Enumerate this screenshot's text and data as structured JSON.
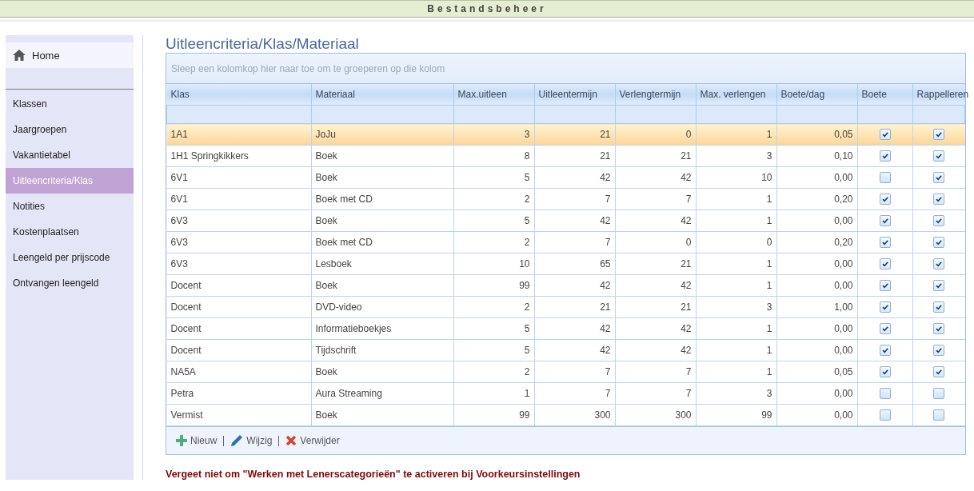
{
  "header": {
    "title": "Bestandsbeheer"
  },
  "sidebar": {
    "home": {
      "label": "Home"
    },
    "items": [
      {
        "label": "Klassen",
        "selected": false
      },
      {
        "label": "Jaargroepen",
        "selected": false
      },
      {
        "label": "Vakantietabel",
        "selected": false
      },
      {
        "label": "Uitleencriteria/Klas",
        "selected": true
      },
      {
        "label": "Notities",
        "selected": false
      },
      {
        "label": "Kostenplaatsen",
        "selected": false
      },
      {
        "label": "Leengeld per prijscode",
        "selected": false
      },
      {
        "label": "Ontvangen leengeld",
        "selected": false
      }
    ]
  },
  "page_title": "Uitleencriteria/Klas/Materiaal",
  "grid": {
    "group_hint": "Sleep een kolomkop hier naar toe om te groeperen op die kolom",
    "columns": [
      {
        "label": "Klas",
        "kind": "text"
      },
      {
        "label": "Materiaal",
        "kind": "text"
      },
      {
        "label": "Max.uitleen",
        "kind": "number"
      },
      {
        "label": "Uitleentermijn",
        "kind": "number"
      },
      {
        "label": "Verlengtermijn",
        "kind": "number"
      },
      {
        "label": "Max. verlengen",
        "kind": "number"
      },
      {
        "label": "Boete/dag",
        "kind": "number"
      },
      {
        "label": "Boete",
        "kind": "check"
      },
      {
        "label": "Rappelleren",
        "kind": "check"
      }
    ],
    "rows": [
      {
        "selected": true,
        "values": [
          "1A1",
          "JoJu",
          "3",
          "21",
          "0",
          "1",
          "0,05"
        ],
        "checks": [
          {
            "checked": true
          },
          {
            "checked": true
          }
        ]
      },
      {
        "selected": false,
        "values": [
          "1H1 Springkikkers",
          "Boek",
          "8",
          "21",
          "21",
          "3",
          "0,10"
        ],
        "checks": [
          {
            "checked": true
          },
          {
            "checked": true
          }
        ]
      },
      {
        "selected": false,
        "values": [
          "6V1",
          "Boek",
          "5",
          "42",
          "42",
          "10",
          "0,00"
        ],
        "checks": [
          {
            "checked": false
          },
          {
            "checked": true
          }
        ]
      },
      {
        "selected": false,
        "values": [
          "6V1",
          "Boek met CD",
          "2",
          "7",
          "7",
          "1",
          "0,20"
        ],
        "checks": [
          {
            "checked": true
          },
          {
            "checked": true
          }
        ]
      },
      {
        "selected": false,
        "values": [
          "6V3",
          "Boek",
          "5",
          "42",
          "42",
          "1",
          "0,00"
        ],
        "checks": [
          {
            "checked": true
          },
          {
            "checked": true
          }
        ]
      },
      {
        "selected": false,
        "values": [
          "6V3",
          "Boek met CD",
          "2",
          "7",
          "0",
          "0",
          "0,20"
        ],
        "checks": [
          {
            "checked": true
          },
          {
            "checked": true
          }
        ]
      },
      {
        "selected": false,
        "values": [
          "6V3",
          "Lesboek",
          "10",
          "65",
          "21",
          "1",
          "0,00"
        ],
        "checks": [
          {
            "checked": true
          },
          {
            "checked": true
          }
        ]
      },
      {
        "selected": false,
        "values": [
          "Docent",
          "Boek",
          "99",
          "42",
          "42",
          "1",
          "0,00"
        ],
        "checks": [
          {
            "checked": true
          },
          {
            "checked": true
          }
        ]
      },
      {
        "selected": false,
        "values": [
          "Docent",
          "DVD-video",
          "2",
          "21",
          "21",
          "3",
          "1,00"
        ],
        "checks": [
          {
            "checked": true
          },
          {
            "checked": true
          }
        ]
      },
      {
        "selected": false,
        "values": [
          "Docent",
          "Informatieboekjes",
          "5",
          "42",
          "42",
          "1",
          "0,00"
        ],
        "checks": [
          {
            "checked": true
          },
          {
            "checked": true
          }
        ]
      },
      {
        "selected": false,
        "values": [
          "Docent",
          "Tijdschrift",
          "5",
          "42",
          "42",
          "1",
          "0,00"
        ],
        "checks": [
          {
            "checked": true
          },
          {
            "checked": true
          }
        ]
      },
      {
        "selected": false,
        "values": [
          "NA5A",
          "Boek",
          "2",
          "7",
          "7",
          "1",
          "0,05"
        ],
        "checks": [
          {
            "checked": true
          },
          {
            "checked": true
          }
        ]
      },
      {
        "selected": false,
        "values": [
          "Petra",
          "Aura Streaming",
          "1",
          "7",
          "7",
          "3",
          "0,00"
        ],
        "checks": [
          {
            "checked": false
          },
          {
            "checked": false
          }
        ]
      },
      {
        "selected": false,
        "values": [
          "Vermist",
          "Boek",
          "99",
          "300",
          "300",
          "99",
          "0,00"
        ],
        "checks": [
          {
            "checked": false
          },
          {
            "checked": false
          }
        ]
      }
    ],
    "actions": [
      {
        "label": "Nieuw",
        "kind": "add"
      },
      {
        "label": "Wijzig",
        "kind": "edit"
      },
      {
        "label": "Verwijder",
        "kind": "delete"
      }
    ]
  },
  "warning": "Vergeet niet om \"Werken met Lenerscategorieën\" te activeren bij Voorkeursinstellingen"
}
